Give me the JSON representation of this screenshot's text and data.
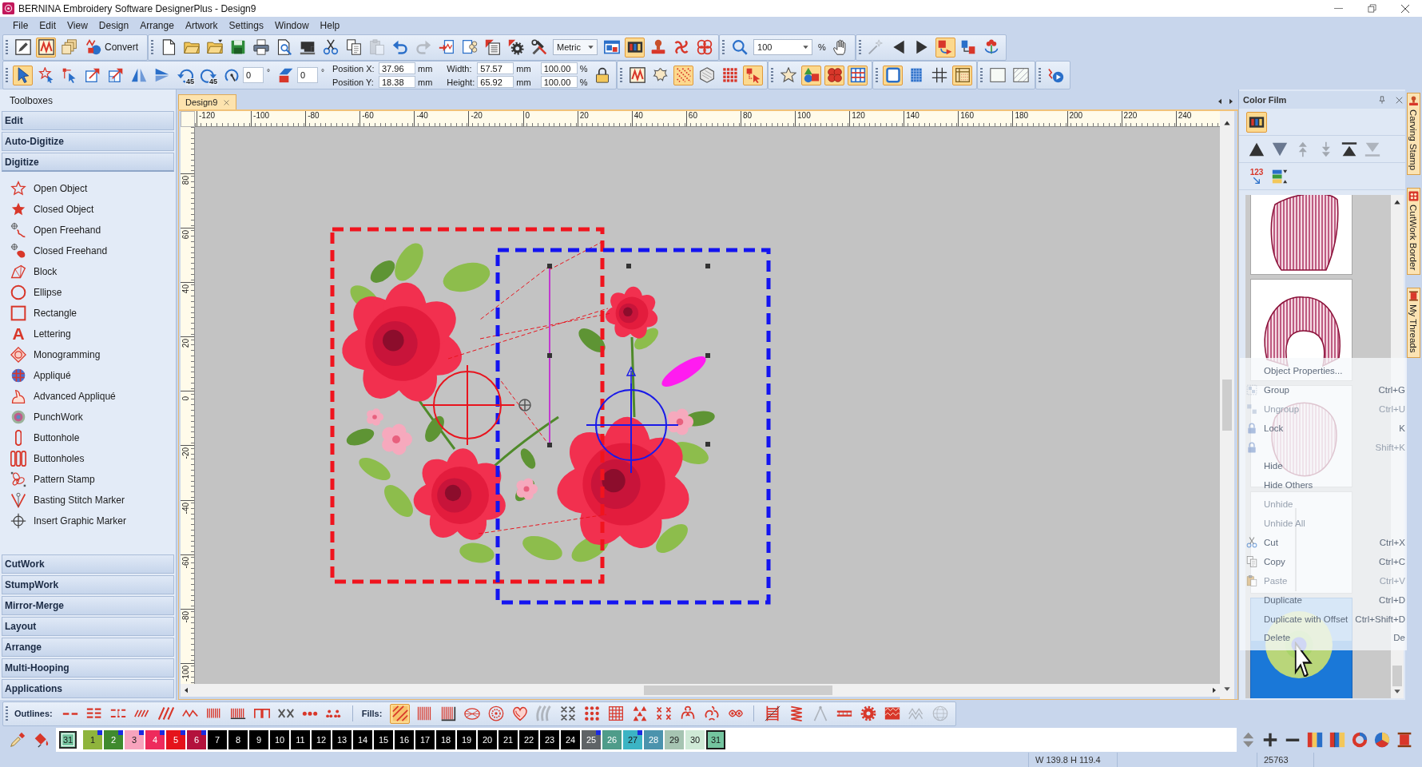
{
  "window": {
    "title": "BERNINA Embroidery Software DesignerPlus - Design9"
  },
  "menu": [
    "File",
    "Edit",
    "View",
    "Design",
    "Arrange",
    "Artwork",
    "Settings",
    "Window",
    "Help"
  ],
  "toolbar_top": {
    "groups": [
      {
        "items": [
          {
            "kind": "button",
            "on": false,
            "disabled": false
          },
          {
            "kind": "button",
            "on": true,
            "disabled": false
          },
          {
            "kind": "button",
            "on": false,
            "disabled": false
          },
          {
            "kind": "button",
            "label": "Convert",
            "on": false,
            "disabled": false
          }
        ]
      },
      {
        "items": [
          {
            "kind": "button",
            "on": false,
            "disabled": false
          },
          {
            "kind": "button",
            "on": false,
            "disabled": false
          },
          {
            "kind": "button",
            "on": false,
            "disabled": false
          },
          {
            "kind": "button",
            "on": false,
            "disabled": false
          },
          {
            "kind": "button",
            "on": false,
            "disabled": false
          },
          {
            "kind": "button",
            "on": false,
            "disabled": false
          },
          {
            "kind": "button",
            "on": false,
            "disabled": false
          },
          {
            "kind": "button",
            "on": false,
            "disabled": false
          },
          {
            "kind": "button",
            "on": false,
            "disabled": false
          },
          {
            "kind": "button",
            "on": false,
            "disabled": true
          },
          {
            "kind": "button",
            "on": false,
            "disabled": false
          },
          {
            "kind": "button",
            "on": false,
            "disabled": true
          },
          {
            "kind": "button",
            "on": false,
            "disabled": false
          },
          {
            "kind": "button",
            "on": false,
            "disabled": false
          },
          {
            "kind": "button",
            "on": false,
            "disabled": false
          },
          {
            "kind": "button",
            "on": false,
            "disabled": false
          },
          {
            "kind": "button",
            "on": false,
            "disabled": false
          },
          {
            "kind": "dropdown",
            "value": "Metric"
          },
          {
            "kind": "button",
            "on": false,
            "disabled": false
          },
          {
            "kind": "button",
            "on": true,
            "disabled": false
          },
          {
            "kind": "button",
            "on": false,
            "disabled": false
          },
          {
            "kind": "button",
            "on": false,
            "disabled": false
          },
          {
            "kind": "button",
            "on": false,
            "disabled": false
          }
        ]
      },
      {
        "items": [
          {
            "kind": "button",
            "on": false,
            "disabled": false
          },
          {
            "kind": "dropdown",
            "value": "100",
            "unit": "%"
          },
          {
            "kind": "button",
            "on": false,
            "disabled": false
          }
        ]
      },
      {
        "items": [
          {
            "kind": "button",
            "on": false,
            "disabled": true
          },
          {
            "kind": "button",
            "on": false,
            "disabled": false
          },
          {
            "kind": "button",
            "on": false,
            "disabled": false
          },
          {
            "kind": "button",
            "on": true,
            "disabled": false
          },
          {
            "kind": "button",
            "on": false,
            "disabled": false
          },
          {
            "kind": "button",
            "on": false,
            "disabled": false
          }
        ]
      }
    ]
  },
  "toolbar_bottom": {
    "groups": [
      {
        "items": [
          {
            "kind": "button",
            "on": true,
            "disabled": false
          },
          {
            "kind": "button",
            "on": false,
            "disabled": false
          },
          {
            "kind": "button",
            "on": false,
            "disabled": false
          },
          {
            "kind": "button",
            "on": false,
            "disabled": false
          },
          {
            "kind": "button",
            "on": false,
            "disabled": false
          },
          {
            "kind": "button",
            "on": false,
            "disabled": false
          },
          {
            "kind": "button",
            "on": false,
            "disabled": false
          },
          {
            "kind": "button",
            "label": "45",
            "on": false,
            "disabled": false
          },
          {
            "kind": "button",
            "label": "45",
            "on": false,
            "disabled": false
          },
          {
            "kind": "angle",
            "value": "0",
            "unit": "°"
          },
          {
            "kind": "angle",
            "value": "0",
            "unit": "°"
          },
          {
            "kind": "fields",
            "rows": [
              {
                "label": "Position X:",
                "value": "37.96",
                "unit": "mm"
              },
              {
                "label": "Position Y:",
                "value": "18.38",
                "unit": "mm"
              }
            ]
          },
          {
            "kind": "fields",
            "rows": [
              {
                "label": "Width:",
                "value": "57.57",
                "unit": "mm",
                "percent": "100.00",
                "percent_unit": "%"
              },
              {
                "label": "Height:",
                "value": "65.92",
                "unit": "mm",
                "percent": "100.00",
                "percent_unit": "%"
              }
            ]
          },
          {
            "kind": "button",
            "on": false,
            "disabled": false
          }
        ]
      },
      {
        "items": [
          {
            "kind": "button",
            "on": false,
            "disabled": false
          },
          {
            "kind": "button",
            "on": false,
            "disabled": false
          },
          {
            "kind": "button",
            "on": true,
            "disabled": false
          },
          {
            "kind": "button",
            "on": false,
            "disabled": false
          },
          {
            "kind": "button",
            "on": false,
            "disabled": false
          },
          {
            "kind": "button",
            "on": true,
            "disabled": false
          }
        ]
      },
      {
        "items": [
          {
            "kind": "button",
            "on": false,
            "disabled": false
          },
          {
            "kind": "button",
            "on": true,
            "disabled": false
          },
          {
            "kind": "button",
            "on": true,
            "disabled": false
          },
          {
            "kind": "button",
            "on": true,
            "disabled": false
          }
        ]
      },
      {
        "items": [
          {
            "kind": "button",
            "on": true,
            "disabled": false
          },
          {
            "kind": "button",
            "on": false,
            "disabled": false
          },
          {
            "kind": "button",
            "on": false,
            "disabled": false
          },
          {
            "kind": "button",
            "on": true,
            "disabled": false
          }
        ]
      },
      {
        "items": [
          {
            "kind": "button",
            "on": false,
            "disabled": false
          },
          {
            "kind": "button",
            "on": false,
            "disabled": false
          }
        ]
      },
      {
        "items": [
          {
            "kind": "button",
            "on": false,
            "disabled": false
          }
        ]
      }
    ]
  },
  "toolboxes": {
    "title": "Toolboxes",
    "sections": [
      {
        "label": "Edit",
        "expanded": false
      },
      {
        "label": "Auto-Digitize",
        "expanded": false
      },
      {
        "label": "Digitize",
        "expanded": true,
        "items": [
          {
            "label": "Open Object"
          },
          {
            "label": "Closed Object"
          },
          {
            "label": "Open Freehand"
          },
          {
            "label": "Closed Freehand"
          },
          {
            "label": "Block"
          },
          {
            "label": "Ellipse"
          },
          {
            "label": "Rectangle"
          },
          {
            "label": "Lettering",
            "glyph": "A"
          },
          {
            "label": "Monogramming"
          },
          {
            "label": "Appliqué"
          },
          {
            "label": "Advanced Appliqué"
          },
          {
            "label": "PunchWork"
          },
          {
            "label": "Buttonhole"
          },
          {
            "label": "Buttonholes"
          },
          {
            "label": "Pattern Stamp"
          },
          {
            "label": "Basting Stitch Marker"
          },
          {
            "label": "Insert Graphic Marker"
          }
        ]
      },
      {
        "label": "CutWork",
        "expanded": false
      },
      {
        "label": "StumpWork",
        "expanded": false
      },
      {
        "label": "Mirror-Merge",
        "expanded": false
      },
      {
        "label": "Layout",
        "expanded": false
      },
      {
        "label": "Arrange",
        "expanded": false
      },
      {
        "label": "Multi-Hooping",
        "expanded": false
      },
      {
        "label": "Applications",
        "expanded": false
      }
    ]
  },
  "document_tabs": [
    {
      "label": "Design9",
      "selected": true
    }
  ],
  "rulers": {
    "horizontal": [
      "-120",
      "-100",
      "-80",
      "-60",
      "-40",
      "-20",
      "0",
      "20",
      "40",
      "60",
      "80",
      "100",
      "120",
      "140",
      "160",
      "180",
      "200",
      "220",
      "240"
    ],
    "vertical": [
      "80",
      "60",
      "40",
      "20",
      "0",
      "-20",
      "-40",
      "-60",
      "-80",
      "-100"
    ]
  },
  "color_film": {
    "title": "Color Film",
    "tool_rows": [
      {
        "items": [
          {
            "on": true,
            "disabled": false
          }
        ]
      },
      {
        "items": [
          {
            "on": false,
            "disabled": false
          },
          {
            "on": false,
            "disabled": false
          },
          {
            "on": false,
            "disabled": true
          },
          {
            "on": false,
            "disabled": true
          },
          {
            "on": false,
            "disabled": false
          },
          {
            "on": false,
            "disabled": true
          }
        ]
      },
      {
        "items": [
          {
            "label": "123",
            "on": false,
            "disabled": false
          },
          {
            "on": false,
            "disabled": false
          }
        ]
      }
    ],
    "cards": [
      {
        "selected": false
      },
      {
        "selected": false
      },
      {
        "selected": false
      },
      {
        "selected": false
      },
      {
        "selected": true
      }
    ]
  },
  "context_menu": {
    "items": [
      {
        "label": "Object Properties...",
        "disabled": false
      },
      {
        "label": "Group",
        "shortcut": "Ctrl+G",
        "disabled": false
      },
      {
        "label": "Ungroup",
        "shortcut": "Ctrl+U",
        "disabled": true
      },
      {
        "label": "Lock",
        "shortcut": "K",
        "disabled": false
      },
      {
        "shortcut": "Shift+K",
        "disabled": true
      },
      {
        "label": "Hide",
        "disabled": false
      },
      {
        "label": "Hide Others",
        "disabled": false
      },
      {
        "label": "Unhide",
        "disabled": true
      },
      {
        "label": "Unhide All",
        "disabled": true
      },
      {
        "label": "Cut",
        "shortcut": "Ctrl+X",
        "disabled": false
      },
      {
        "label": "Copy",
        "shortcut": "Ctrl+C",
        "disabled": false
      },
      {
        "label": "Paste",
        "shortcut": "Ctrl+V",
        "disabled": true
      },
      {
        "label": "Duplicate",
        "shortcut": "Ctrl+D",
        "disabled": false
      },
      {
        "label": "Duplicate with Offset",
        "shortcut": "Ctrl+Shift+D",
        "disabled": false
      },
      {
        "label": "Delete",
        "shortcut": "De",
        "disabled": false
      }
    ]
  },
  "side_tabs": [
    {
      "label": "Carving Stamp"
    },
    {
      "label": "CutWork Border"
    },
    {
      "label": "My Threads"
    }
  ],
  "stitch_toolbar": {
    "groups": [
      {
        "label": "Outlines:",
        "items": [
          {
            "on": false,
            "disabled": false
          },
          {
            "on": false,
            "disabled": false
          },
          {
            "on": false,
            "disabled": false
          },
          {
            "on": false,
            "disabled": false
          },
          {
            "on": false,
            "disabled": false
          },
          {
            "on": false,
            "disabled": false
          },
          {
            "on": false,
            "disabled": false
          },
          {
            "on": false,
            "disabled": false
          },
          {
            "on": false,
            "disabled": false
          },
          {
            "on": false,
            "disabled": false
          },
          {
            "on": false,
            "disabled": false
          },
          {
            "on": false,
            "disabled": false
          }
        ]
      },
      {
        "label": "Fills:",
        "items": [
          {
            "on": true,
            "disabled": false
          },
          {
            "on": false,
            "disabled": false
          },
          {
            "on": false,
            "disabled": false
          },
          {
            "on": false,
            "disabled": false
          },
          {
            "on": false,
            "disabled": false
          },
          {
            "on": false,
            "disabled": false
          },
          {
            "on": false,
            "disabled": true
          },
          {
            "on": false,
            "disabled": false
          },
          {
            "on": false,
            "disabled": false
          },
          {
            "on": false,
            "disabled": false
          },
          {
            "on": false,
            "disabled": false
          },
          {
            "on": false,
            "disabled": false
          },
          {
            "on": false,
            "disabled": false
          },
          {
            "on": false,
            "disabled": false
          },
          {
            "on": false,
            "disabled": false
          }
        ]
      },
      {
        "items": [
          {
            "on": false,
            "disabled": false
          },
          {
            "on": false,
            "disabled": false
          },
          {
            "on": false,
            "disabled": true
          },
          {
            "on": false,
            "disabled": false
          },
          {
            "on": false,
            "disabled": false
          },
          {
            "on": false,
            "disabled": false
          },
          {
            "on": false,
            "disabled": true
          },
          {
            "on": false,
            "disabled": true
          }
        ]
      }
    ]
  },
  "thread_bar": {
    "current": {
      "label": "31",
      "color": "#74c49f"
    },
    "swatches": [
      {
        "label": "1",
        "color": "#8fb43c",
        "used": true,
        "selected": false
      },
      {
        "label": "2",
        "color": "#3f8a2e",
        "used": true,
        "selected": false
      },
      {
        "label": "3",
        "color": "#f7a3bd",
        "used": true,
        "selected": false
      },
      {
        "label": "4",
        "color": "#ee2b5c",
        "used": true,
        "selected": false
      },
      {
        "label": "5",
        "color": "#e5131b",
        "used": true,
        "selected": false
      },
      {
        "label": "6",
        "color": "#b3123c",
        "used": true,
        "selected": false
      },
      {
        "label": "7",
        "color": "#000000",
        "used": false,
        "selected": false
      },
      {
        "label": "8",
        "color": "#000000",
        "used": false,
        "selected": false
      },
      {
        "label": "9",
        "color": "#000000",
        "used": false,
        "selected": false
      },
      {
        "label": "10",
        "color": "#000000",
        "used": false,
        "selected": false
      },
      {
        "label": "11",
        "color": "#000000",
        "used": false,
        "selected": false
      },
      {
        "label": "12",
        "color": "#000000",
        "used": false,
        "selected": false
      },
      {
        "label": "13",
        "color": "#000000",
        "used": false,
        "selected": false
      },
      {
        "label": "14",
        "color": "#000000",
        "used": false,
        "selected": false
      },
      {
        "label": "15",
        "color": "#000000",
        "used": false,
        "selected": false
      },
      {
        "label": "16",
        "color": "#000000",
        "used": false,
        "selected": false
      },
      {
        "label": "17",
        "color": "#000000",
        "used": false,
        "selected": false
      },
      {
        "label": "18",
        "color": "#000000",
        "used": false,
        "selected": false
      },
      {
        "label": "19",
        "color": "#000000",
        "used": false,
        "selected": false
      },
      {
        "label": "20",
        "color": "#000000",
        "used": false,
        "selected": false
      },
      {
        "label": "21",
        "color": "#000000",
        "used": false,
        "selected": false
      },
      {
        "label": "22",
        "color": "#000000",
        "used": false,
        "selected": false
      },
      {
        "label": "23",
        "color": "#000000",
        "used": false,
        "selected": false
      },
      {
        "label": "24",
        "color": "#000000",
        "used": false,
        "selected": false
      },
      {
        "label": "25",
        "color": "#5f6366",
        "used": true,
        "selected": false
      },
      {
        "label": "26",
        "color": "#4f9c8a",
        "used": false,
        "selected": false
      },
      {
        "label": "27",
        "color": "#3cb4c4",
        "used": true,
        "selected": false
      },
      {
        "label": "28",
        "color": "#4b93ad",
        "used": false,
        "selected": false
      },
      {
        "label": "29",
        "color": "#a6c4b2",
        "used": false,
        "selected": false
      },
      {
        "label": "30",
        "color": "#cfe9d6",
        "used": false,
        "selected": false
      },
      {
        "label": "31",
        "color": "#74c49f",
        "used": false,
        "selected": true
      }
    ]
  },
  "status_bar": {
    "dimensions": "W 139.8 H 119.4",
    "stitch_count": "25763"
  }
}
